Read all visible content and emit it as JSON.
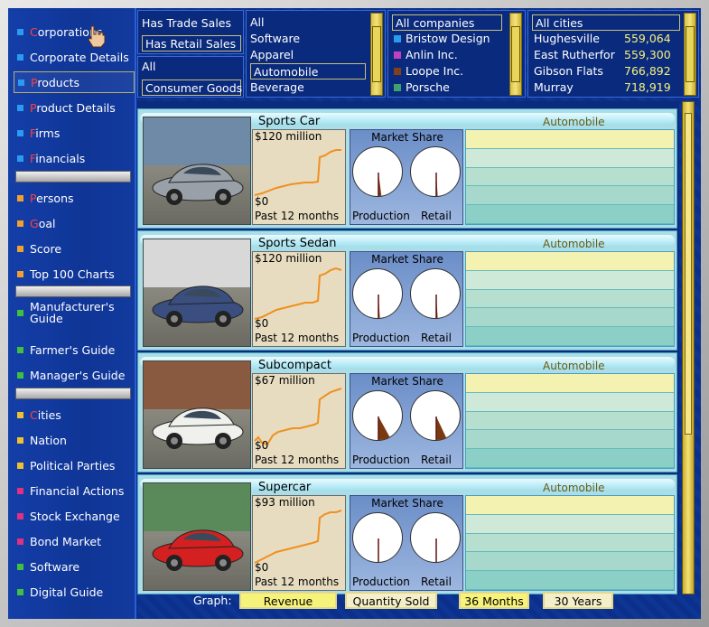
{
  "sidebar": {
    "items": [
      {
        "label": "Corporations",
        "first": "C",
        "color": "#2a9bf0"
      },
      {
        "label": "Corporate Details",
        "first": "",
        "color": "#2a9bf0"
      },
      {
        "label": "Products",
        "first": "P",
        "color": "#2a9bf0",
        "selected": true
      },
      {
        "label": "Product Details",
        "first": "P",
        "color": "#2a9bf0"
      },
      {
        "label": "Firms",
        "first": "F",
        "color": "#2a9bf0"
      },
      {
        "label": "Financials",
        "first": "F",
        "color": "#2a9bf0"
      },
      {
        "label": "Persons",
        "first": "P",
        "color": "#f0a030"
      },
      {
        "label": "Goal",
        "first": "G",
        "color": "#f0a030"
      },
      {
        "label": "Score",
        "first": "",
        "color": "#f0a030"
      },
      {
        "label": "Top 100 Charts",
        "first": "",
        "color": "#f0a030"
      },
      {
        "label": "Manufacturer's Guide",
        "first": "",
        "color": "#40c040"
      },
      {
        "label": "Farmer's Guide",
        "first": "",
        "color": "#40c040"
      },
      {
        "label": "Manager's Guide",
        "first": "",
        "color": "#40c040"
      },
      {
        "label": "Cities",
        "first": "C",
        "color": "#f0c030"
      },
      {
        "label": "Nation",
        "first": "",
        "color": "#f0c030"
      },
      {
        "label": "Political Parties",
        "first": "",
        "color": "#f0c030"
      },
      {
        "label": "Financial Actions",
        "first": "",
        "color": "#e03080"
      },
      {
        "label": "Stock Exchange",
        "first": "",
        "color": "#e03080"
      },
      {
        "label": "Bond Market",
        "first": "",
        "color": "#e03080"
      },
      {
        "label": "Software",
        "first": "",
        "color": "#40c040"
      },
      {
        "label": "Digital Guide",
        "first": "",
        "color": "#40c040"
      }
    ]
  },
  "filters": {
    "sales_a": "Has Trade Sales",
    "sales_b": "Has Retail Sales",
    "scope_a": "All",
    "scope_b": "Consumer Goods",
    "categories": [
      "All",
      "Software",
      "Apparel",
      "Automobile",
      "Beverage"
    ],
    "companies_header": "All companies",
    "companies": [
      {
        "name": "Bristow Design",
        "color": "#2a9bf0"
      },
      {
        "name": "Anlin Inc.",
        "color": "#c040c0"
      },
      {
        "name": "Loope Inc.",
        "color": "#804020"
      },
      {
        "name": "Porsche",
        "color": "#40a070"
      }
    ],
    "cities_header": "All cities",
    "cities": [
      {
        "name": "Hughesville",
        "value": "559,064"
      },
      {
        "name": "East Rutherfor",
        "value": "559,300"
      },
      {
        "name": "Gibson Flats",
        "value": "766,892"
      },
      {
        "name": "Murray",
        "value": "718,919"
      }
    ]
  },
  "products": [
    {
      "name": "Sports Car",
      "category": "Automobile",
      "value": "$120 million",
      "zero": "$0",
      "period": "Past 12 months",
      "market_share": "Market Share",
      "production": "Production",
      "retail": "Retail",
      "car_color": "#9aa0a8",
      "bg": "#6f8aa6"
    },
    {
      "name": "Sports Sedan",
      "category": "Automobile",
      "value": "$120 million",
      "zero": "$0",
      "period": "Past 12 months",
      "market_share": "Market Share",
      "production": "Production",
      "retail": "Retail",
      "car_color": "#3a4e80",
      "bg": "#d8d8d8"
    },
    {
      "name": "Subcompact",
      "category": "Automobile",
      "value": "$67 million",
      "zero": "$0",
      "period": "Past 12 months",
      "market_share": "Market Share",
      "production": "Production",
      "retail": "Retail",
      "car_color": "#f0f0ec",
      "bg": "#8a5a40"
    },
    {
      "name": "Supercar",
      "category": "Automobile",
      "value": "$93 million",
      "zero": "$0",
      "period": "Past 12 months",
      "market_share": "Market Share",
      "production": "Production",
      "retail": "Retail",
      "car_color": "#d42020",
      "bg": "#5a8a5a"
    }
  ],
  "bottom": {
    "graph_label": "Graph:",
    "revenue": "Revenue",
    "quantity": "Quantity Sold",
    "months": "36 Months",
    "years": "30 Years"
  }
}
